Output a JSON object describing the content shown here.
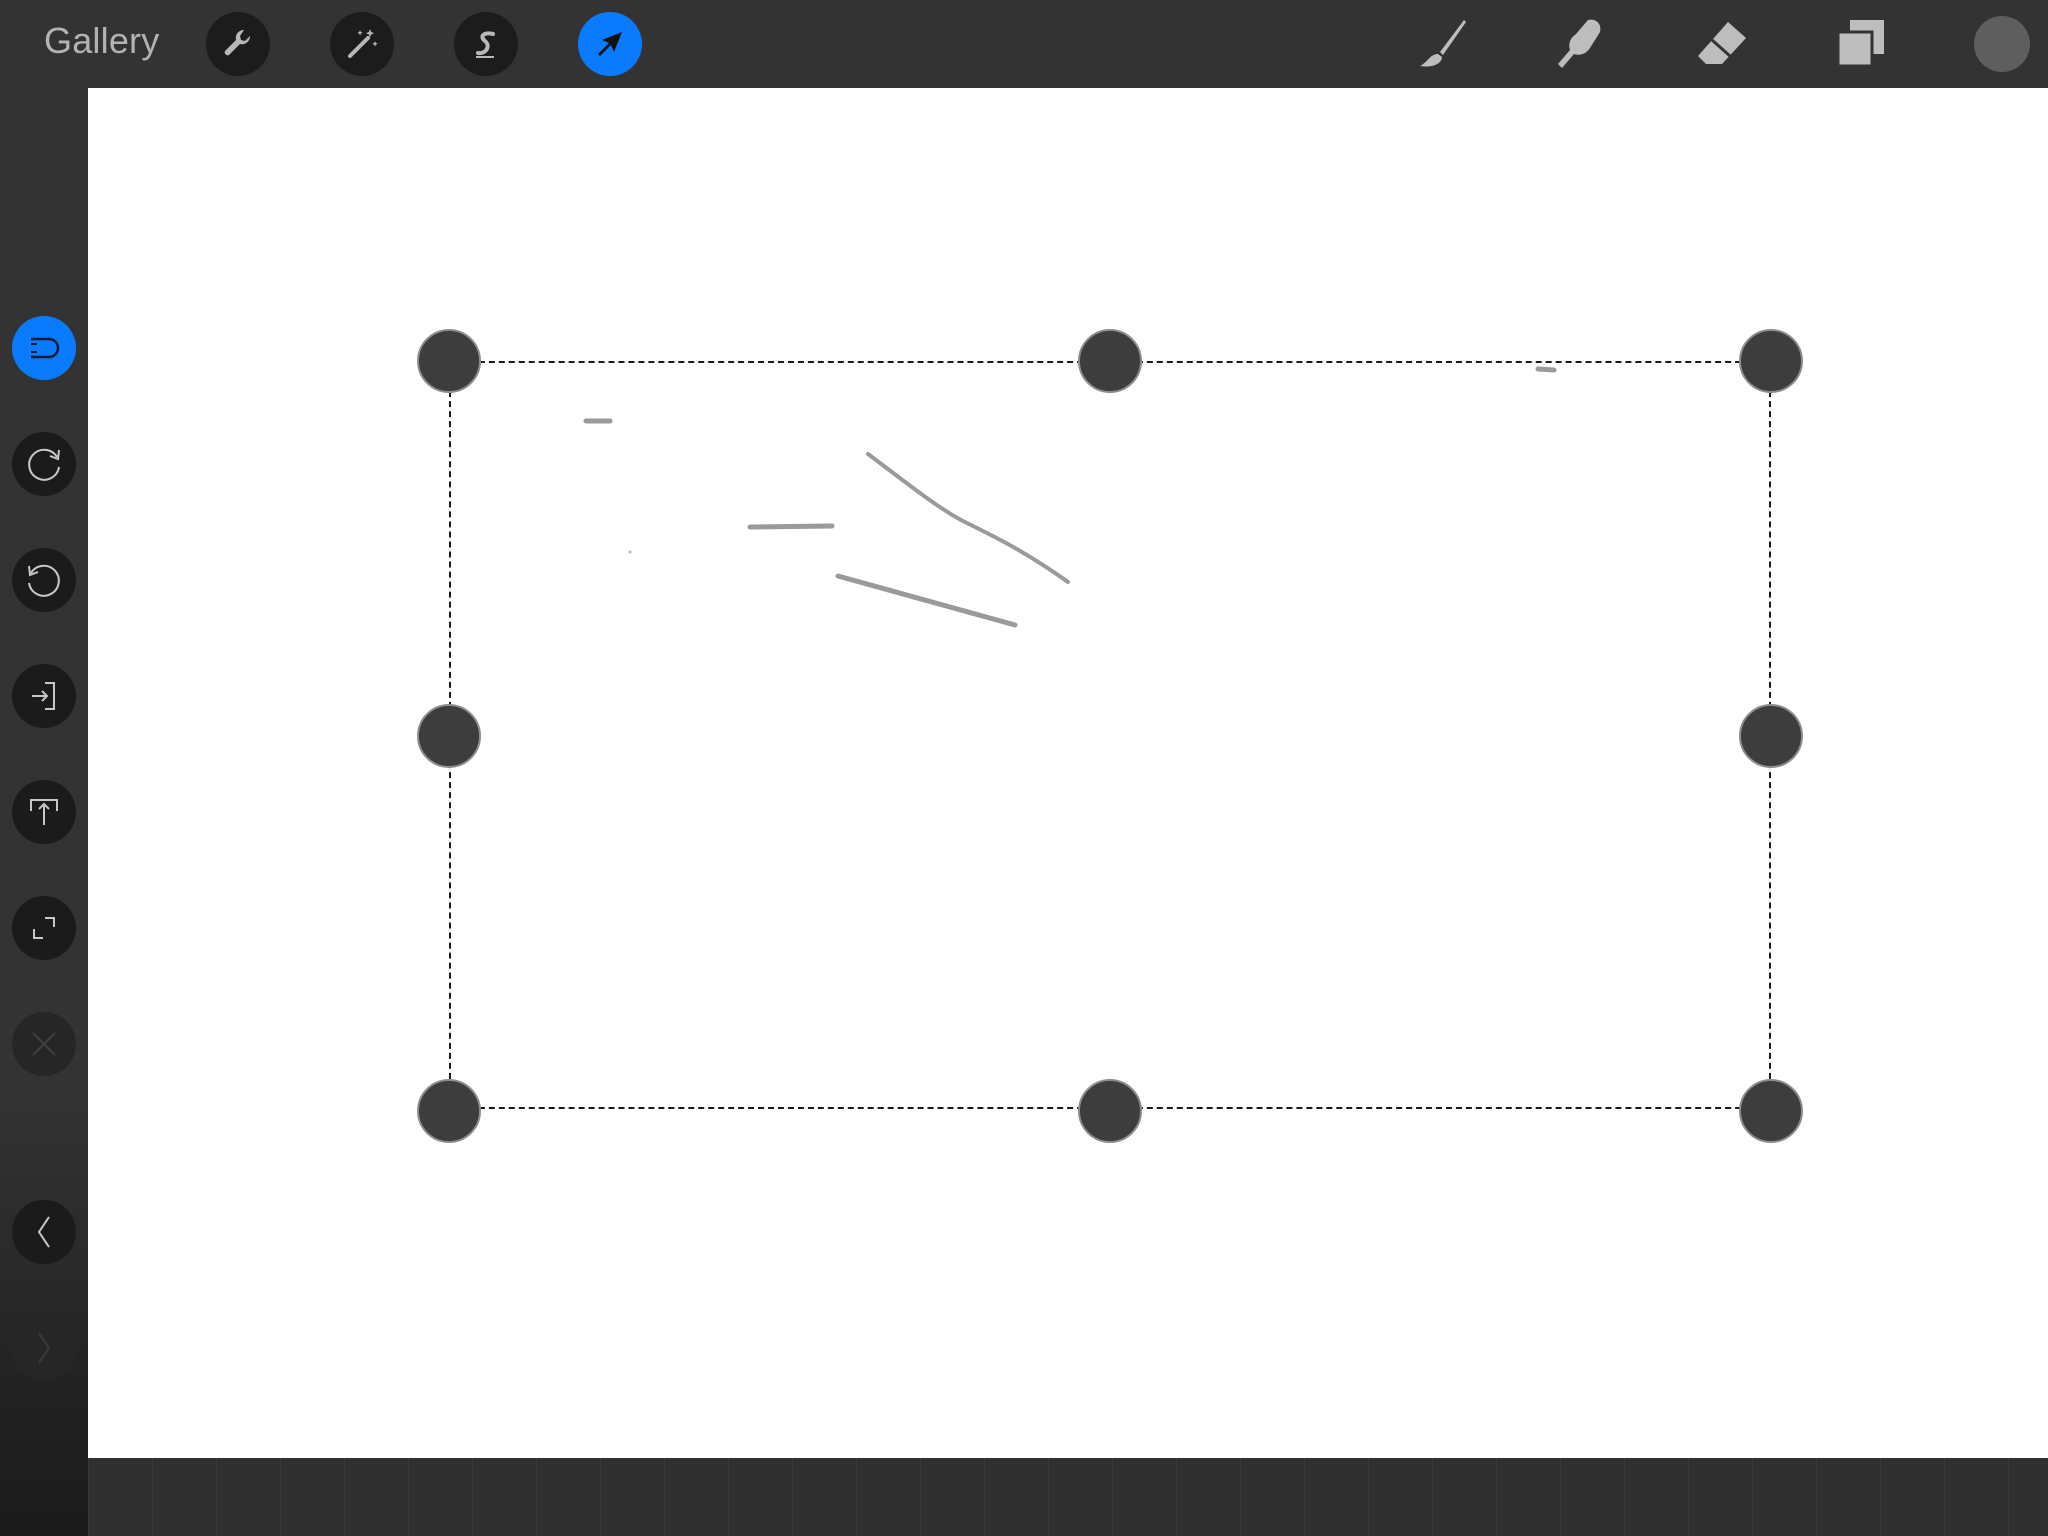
{
  "topbar": {
    "gallery_label": "Gallery",
    "left_tools": [
      {
        "name": "actions",
        "icon": "wrench-icon",
        "active": false
      },
      {
        "name": "adjustments",
        "icon": "magic-wand-icon",
        "active": false
      },
      {
        "name": "selection",
        "icon": "selection-s-icon",
        "active": false
      },
      {
        "name": "transform",
        "icon": "arrow-cursor-icon",
        "active": true
      }
    ],
    "right_tools": [
      {
        "name": "brush",
        "icon": "brush-icon"
      },
      {
        "name": "smudge",
        "icon": "smudge-finger-icon"
      },
      {
        "name": "eraser",
        "icon": "eraser-icon"
      },
      {
        "name": "layers",
        "icon": "layers-icon"
      }
    ],
    "current_color": "#5e5e5e"
  },
  "sidebar": {
    "buttons": [
      {
        "name": "magnetics",
        "icon": "magnet-icon",
        "state": "active"
      },
      {
        "name": "rotate-clockwise",
        "icon": "rotate-cw-icon",
        "state": "normal"
      },
      {
        "name": "rotate-counterclockwise",
        "icon": "rotate-ccw-icon",
        "state": "normal"
      },
      {
        "name": "flip-horizontal",
        "icon": "flip-horizontal-icon",
        "state": "normal"
      },
      {
        "name": "flip-vertical",
        "icon": "flip-vertical-icon",
        "state": "normal"
      },
      {
        "name": "fit-to-screen",
        "icon": "fit-screen-icon",
        "state": "normal"
      },
      {
        "name": "reset",
        "icon": "close-icon",
        "state": "disabled"
      },
      {
        "name": "undo",
        "icon": "chevron-left-icon",
        "state": "normal"
      },
      {
        "name": "redo",
        "icon": "chevron-right-icon",
        "state": "disabled"
      }
    ]
  },
  "canvas": {
    "background": "#ffffff",
    "stroke_color": "#9a9a9a"
  },
  "colors": {
    "accent": "#0a7bff",
    "toolbar": "#333333",
    "button_bg": "#1c1c1c",
    "handle": "#3d3d3d"
  }
}
